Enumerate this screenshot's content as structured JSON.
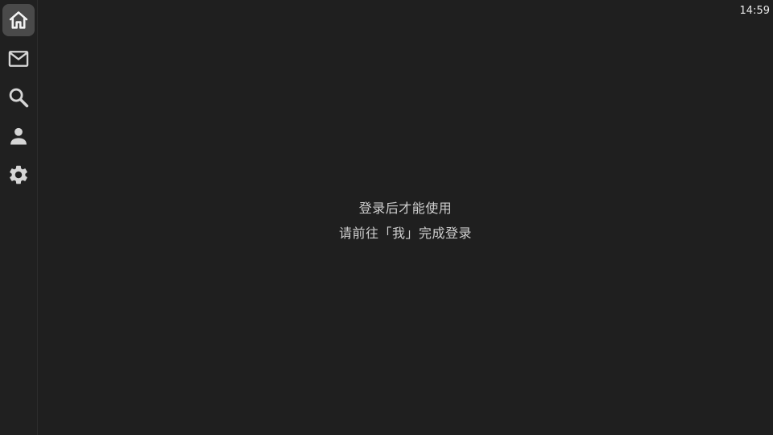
{
  "status_bar": {
    "time": "14:59"
  },
  "sidebar": {
    "items": [
      {
        "id": "home",
        "icon": "home-icon",
        "active": true
      },
      {
        "id": "messages",
        "icon": "mail-icon",
        "active": false
      },
      {
        "id": "search",
        "icon": "search-icon",
        "active": false
      },
      {
        "id": "profile",
        "icon": "person-icon",
        "active": false
      },
      {
        "id": "settings",
        "icon": "gear-icon",
        "active": false
      }
    ]
  },
  "main": {
    "message_line1": "登录后才能使用",
    "message_line2": "请前往「我」完成登录"
  },
  "colors": {
    "background": "#1f1f1f",
    "sidebar_active": "#4a4a4a",
    "icon": "#d6d6d6",
    "text": "#cfcfcf"
  }
}
